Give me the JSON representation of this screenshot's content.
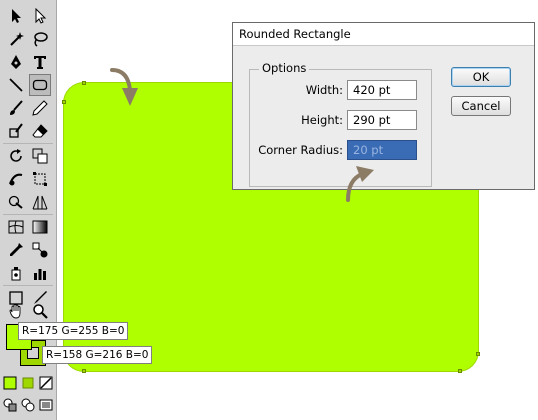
{
  "dialog": {
    "title": "Rounded Rectangle",
    "options_legend": "Options",
    "width_label": "Width:",
    "width_value": "420 pt",
    "height_label": "Height:",
    "height_value": "290 pt",
    "corner_radius_label": "Corner Radius:",
    "corner_radius_value": "20 pt",
    "ok_label": "OK",
    "cancel_label": "Cancel"
  },
  "color_readouts": {
    "fill": "R=175 G=255 B=0",
    "stroke": "R=158 G=216 B=0"
  },
  "colors": {
    "fill": "#afff00",
    "stroke": "#9ed800",
    "annotation_arrow": "#8c7c66"
  },
  "tools": [
    "selection-tool",
    "direct-selection-tool",
    "magic-wand-tool",
    "lasso-tool",
    "pen-tool",
    "type-tool",
    "line-segment-tool",
    "rounded-rectangle-tool",
    "paintbrush-tool",
    "pencil-tool",
    "blob-brush-tool",
    "eraser-tool",
    "rotate-tool",
    "scale-tool",
    "warp-tool",
    "free-transform-tool",
    "shape-builder-tool",
    "perspective-grid-tool",
    "mesh-tool",
    "gradient-tool",
    "eyedropper-tool",
    "blend-tool",
    "symbol-sprayer-tool",
    "column-graph-tool",
    "artboard-tool",
    "slice-tool",
    "hand-tool",
    "zoom-tool"
  ]
}
